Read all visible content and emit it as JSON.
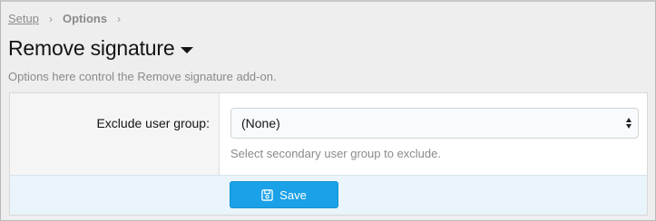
{
  "breadcrumb": {
    "items": [
      {
        "label": "Setup"
      },
      {
        "label": "Options"
      }
    ],
    "separator": "›"
  },
  "page": {
    "title": "Remove signature",
    "description": "Options here control the Remove signature add-on."
  },
  "form": {
    "field_label": "Exclude user group:",
    "select_value": "(None)",
    "hint": "Select secondary user group to exclude.",
    "save_label": "Save"
  },
  "colors": {
    "accent": "#1aa1e8",
    "footer_bg": "#eaf4fb",
    "muted_text": "#8a8a8a"
  },
  "icons": {
    "save": "floppy-disk-icon",
    "title_menu": "caret-down-icon",
    "select": "select-updown-icon"
  }
}
